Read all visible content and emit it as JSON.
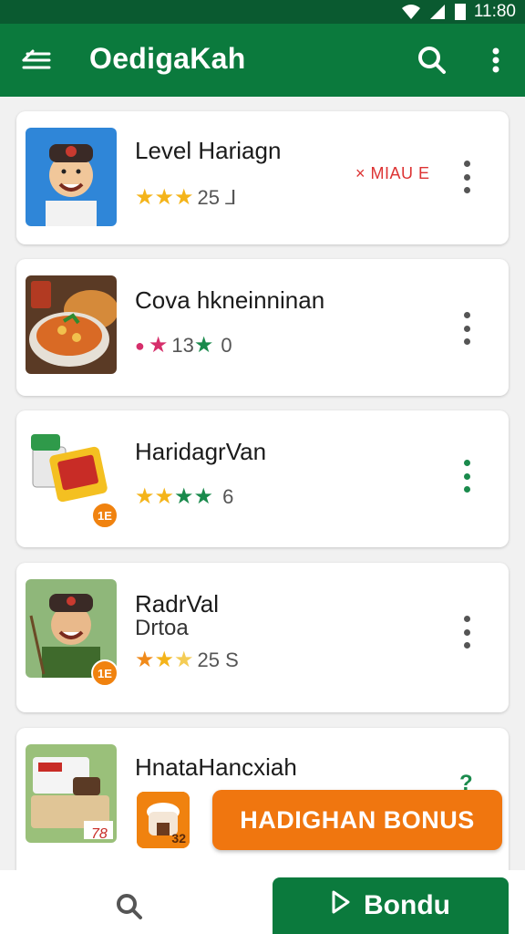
{
  "status_bar": {
    "time": "11:80"
  },
  "app_bar": {
    "title": "OedigaKah"
  },
  "colors": {
    "primary": "#0b7a3d",
    "accent": "#f0760f",
    "star": "#f4b41a",
    "star_green": "#1a8a4c"
  },
  "cards": [
    {
      "name": "Level Hariagn",
      "rating_text": "25 ⅃",
      "badge": "× MIAU E",
      "stars": 3
    },
    {
      "name": "Cova hkneinninan",
      "rating_text": "13",
      "rating_text_2": "0"
    },
    {
      "name": "HaridagrVan",
      "rating_text": "6",
      "age_badge": "1E"
    },
    {
      "name": "RadrVal",
      "subtitle": "Drtoa",
      "rating_text": "25 S",
      "age_badge": "1E"
    },
    {
      "name": "HnataHancxiah",
      "thumb_label": "78"
    }
  ],
  "bonus": {
    "icon_label": "32",
    "button_label": "HADIGHAN BONUS",
    "help_mark": "?"
  },
  "bottom_bar": {
    "button_label": "Bondu"
  },
  "icons": [
    "menu-icon",
    "search-icon",
    "more-vert-icon",
    "wifi-icon",
    "signal-icon",
    "battery-icon",
    "play-icon",
    "star-icon",
    "dot-icon"
  ]
}
